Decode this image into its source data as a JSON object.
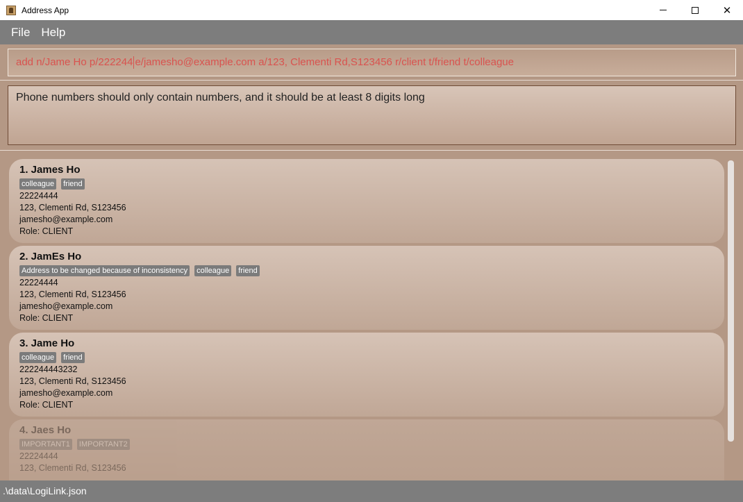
{
  "window": {
    "title": "Address App",
    "minimize": "—",
    "close": "✕"
  },
  "menu": {
    "file": "File",
    "help": "Help"
  },
  "command": {
    "before_caret": "add n/Jame Ho p/222244",
    "after_caret": "e/jamesho@example.com a/123, Clementi Rd,S123456 r/client t/friend t/colleague"
  },
  "result": {
    "message": "Phone numbers should only contain numbers, and it should be at least 8 digits long"
  },
  "persons": [
    {
      "name": "1. James Ho",
      "tags": [
        "colleague",
        "friend"
      ],
      "phone": "22224444",
      "address": "123, Clementi Rd, S123456",
      "email": "jamesho@example.com",
      "role": "Role: CLIENT"
    },
    {
      "name": "2. JamEs Ho",
      "tags": [
        "Address to be changed because of inconsistency",
        "colleague",
        "friend"
      ],
      "phone": "22224444",
      "address": "123, Clementi Rd, S123456",
      "email": "jamesho@example.com",
      "role": "Role: CLIENT"
    },
    {
      "name": "3. Jame Ho",
      "tags": [
        "colleague",
        "friend"
      ],
      "phone": "222244443232",
      "address": "123, Clementi Rd, S123456",
      "email": "jamesho@example.com",
      "role": "Role: CLIENT"
    },
    {
      "name": "4. Jaes Ho",
      "tags": [
        "IMPORTANT1",
        "IMPORTANT2"
      ],
      "phone": "22224444",
      "address": "123, Clementi Rd, S123456",
      "email": "",
      "role": ""
    }
  ],
  "status": {
    "file_path": ".\\data\\LogiLink.json"
  }
}
